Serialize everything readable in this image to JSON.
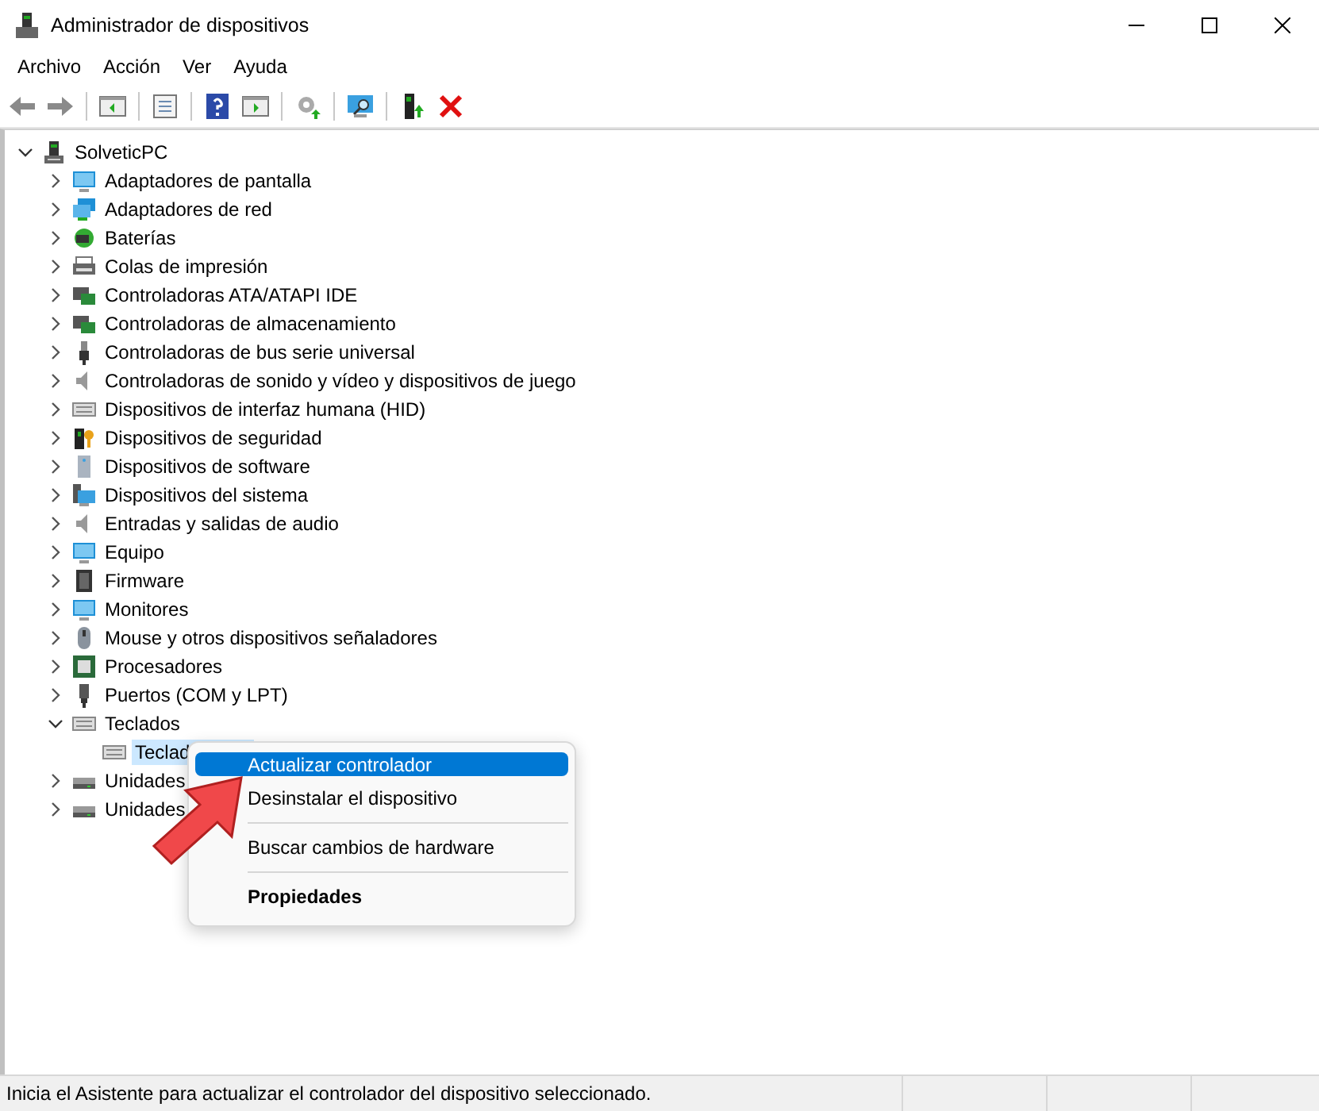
{
  "window": {
    "title": "Administrador de dispositivos"
  },
  "menu_bar": [
    "Archivo",
    "Acción",
    "Ver",
    "Ayuda"
  ],
  "tree": {
    "label": "SolveticPC",
    "expanded": true,
    "selected": false,
    "children": [
      {
        "label": "Adaptadores de pantalla",
        "expanded": false,
        "selected": false
      },
      {
        "label": "Adaptadores de red",
        "expanded": false,
        "selected": false
      },
      {
        "label": "Baterías",
        "expanded": false,
        "selected": false
      },
      {
        "label": "Colas de impresión",
        "expanded": false,
        "selected": false
      },
      {
        "label": "Controladoras ATA/ATAPI IDE",
        "expanded": false,
        "selected": false
      },
      {
        "label": "Controladoras de almacenamiento",
        "expanded": false,
        "selected": false
      },
      {
        "label": "Controladoras de bus serie universal",
        "expanded": false,
        "selected": false
      },
      {
        "label": "Controladoras de sonido y vídeo y dispositivos de juego",
        "expanded": false,
        "selected": false
      },
      {
        "label": "Dispositivos de interfaz humana (HID)",
        "expanded": false,
        "selected": false
      },
      {
        "label": "Dispositivos de seguridad",
        "expanded": false,
        "selected": false
      },
      {
        "label": "Dispositivos de software",
        "expanded": false,
        "selected": false
      },
      {
        "label": "Dispositivos del sistema",
        "expanded": false,
        "selected": false
      },
      {
        "label": "Entradas y salidas de audio",
        "expanded": false,
        "selected": false
      },
      {
        "label": "Equipo",
        "expanded": false,
        "selected": false
      },
      {
        "label": "Firmware",
        "expanded": false,
        "selected": false
      },
      {
        "label": "Monitores",
        "expanded": false,
        "selected": false
      },
      {
        "label": "Mouse y otros dispositivos señaladores",
        "expanded": false,
        "selected": false
      },
      {
        "label": "Procesadores",
        "expanded": false,
        "selected": false
      },
      {
        "label": "Puertos (COM y LPT)",
        "expanded": false,
        "selected": false
      },
      {
        "label": "Teclados",
        "expanded": true,
        "selected": false,
        "children": [
          {
            "label": "Teclad",
            "selected": true
          }
        ]
      },
      {
        "label": "Unidades",
        "expanded": false,
        "selected": false
      },
      {
        "label": "Unidades",
        "expanded": false,
        "selected": false
      }
    ]
  },
  "context_menu": [
    {
      "kind": "item",
      "label": "Actualizar controlador",
      "highlighted": true,
      "bold": false
    },
    {
      "kind": "item",
      "label": "Desinstalar el dispositivo",
      "highlighted": false,
      "bold": false
    },
    {
      "kind": "separator"
    },
    {
      "kind": "item",
      "label": "Buscar cambios de hardware",
      "highlighted": false,
      "bold": false
    },
    {
      "kind": "separator"
    },
    {
      "kind": "item",
      "label": "Propiedades",
      "highlighted": false,
      "bold": true
    }
  ],
  "status_bar": "Inicia el Asistente para actualizar el controlador del dispositivo seleccionado."
}
